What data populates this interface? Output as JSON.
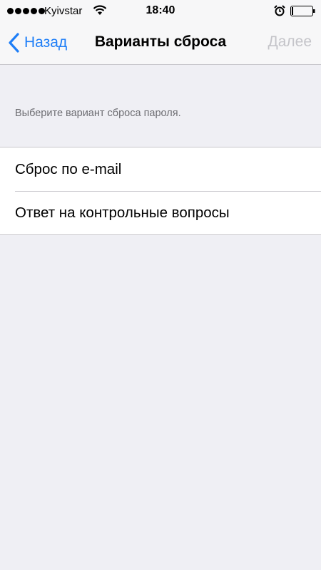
{
  "status_bar": {
    "carrier": "Kyivstar",
    "time": "18:40",
    "signal_icon": "signal-dots-icon",
    "wifi_icon": "wifi-icon",
    "alarm_icon": "alarm-clock-icon",
    "battery_icon": "battery-icon"
  },
  "nav": {
    "back_label": "Назад",
    "title": "Варианты сброса",
    "next_label": "Далее",
    "accent_color": "#1e7ef7",
    "disabled_color": "#c4c4c9"
  },
  "content": {
    "hint": "Выберите вариант сброса пароля.",
    "options": [
      {
        "label": "Сброс по e-mail"
      },
      {
        "label": "Ответ на контрольные вопросы"
      }
    ]
  }
}
